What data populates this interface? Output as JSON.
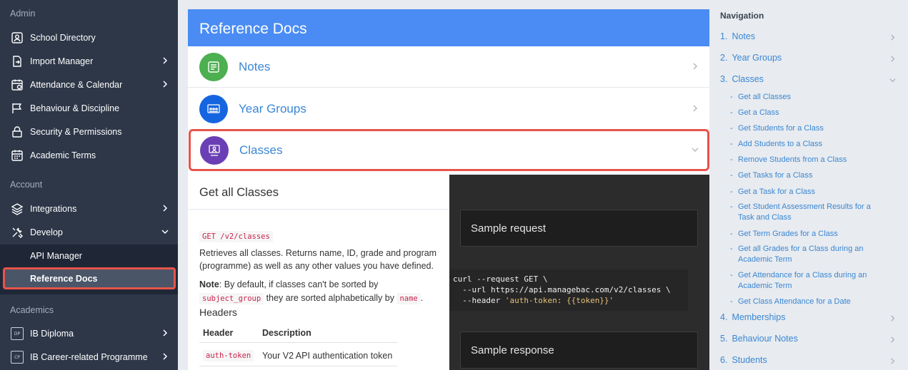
{
  "sidebar": {
    "sections": {
      "admin": "Admin",
      "account": "Account",
      "academics": "Academics"
    },
    "items": [
      {
        "label": "School Directory",
        "icon": "directory-icon",
        "chevron": false
      },
      {
        "label": "Import Manager",
        "icon": "import-icon",
        "chevron": true
      },
      {
        "label": "Attendance & Calendar",
        "icon": "calendar-icon",
        "chevron": true
      },
      {
        "label": "Behaviour & Discipline",
        "icon": "flag-icon",
        "chevron": false
      },
      {
        "label": "Security & Permissions",
        "icon": "lock-icon",
        "chevron": false
      },
      {
        "label": "Academic Terms",
        "icon": "terms-icon",
        "chevron": false
      },
      {
        "label": "Integrations",
        "icon": "layers-icon",
        "chevron": true
      },
      {
        "label": "Develop",
        "icon": "tools-icon",
        "chevron": true
      },
      {
        "label": "IB Diploma",
        "icon": "dp-badge",
        "chevron": true,
        "badge": "DP"
      },
      {
        "label": "IB Career-related Programme",
        "icon": "cp-badge",
        "chevron": true,
        "badge": "CP"
      }
    ],
    "develop_sub": [
      {
        "label": "API Manager"
      },
      {
        "label": "Reference Docs",
        "active": true
      }
    ]
  },
  "main": {
    "header": "Reference Docs",
    "accordion": [
      {
        "label": "Notes",
        "color": "#4caf50",
        "icon": "notes-icon"
      },
      {
        "label": "Year Groups",
        "color": "#1565e0",
        "icon": "year-groups-icon"
      },
      {
        "label": "Classes",
        "color": "#6a3fb5",
        "icon": "classes-icon",
        "expanded": true
      }
    ],
    "section_title": "Get all Classes",
    "endpoint": "GET /v2/classes",
    "description": "Retrieves all classes. Returns name, ID, grade and program (programme) as well as any other values you have defined.",
    "note_label": "Note",
    "note_text_1": ": By default, if classes can't be sorted by",
    "note_code_1": "subject_group",
    "note_text_2": "they are sorted alphabetically by",
    "note_code_2": "name",
    "note_text_3": ".",
    "headers_title": "Headers",
    "table": {
      "columns": [
        "Header",
        "Description"
      ],
      "rows": [
        [
          "auth-token",
          "Your V2 API authentication token"
        ]
      ]
    },
    "sample_request": "Sample request",
    "sample_response": "Sample response",
    "code": {
      "line1": "curl --request GET \\",
      "line2": "  --url https://api.managebac.com/v2/classes \\",
      "line3_prefix": "  --header ",
      "line3_string": "'auth-token: {{token}}'"
    }
  },
  "right_nav": {
    "title": "Navigation",
    "items": [
      {
        "num": "1.",
        "label": "Notes"
      },
      {
        "num": "2.",
        "label": "Year Groups"
      },
      {
        "num": "3.",
        "label": "Classes",
        "expanded": true
      },
      {
        "num": "4.",
        "label": "Memberships"
      },
      {
        "num": "5.",
        "label": "Behaviour Notes"
      },
      {
        "num": "6.",
        "label": "Students"
      }
    ],
    "class_subitems": [
      "Get all Classes",
      "Get a Class",
      "Get Students for a Class",
      "Add Students to a Class",
      "Remove Students from a Class",
      "Get Tasks for a Class",
      "Get a Task for a Class",
      "Get Student Assessment Results for a Task and Class",
      "Get Term Grades for a Class",
      "Get all Grades for a Class during an Academic Term",
      "Get Attendance for a Class during an Academic Term",
      "Get Class Attendance for a Date"
    ]
  }
}
